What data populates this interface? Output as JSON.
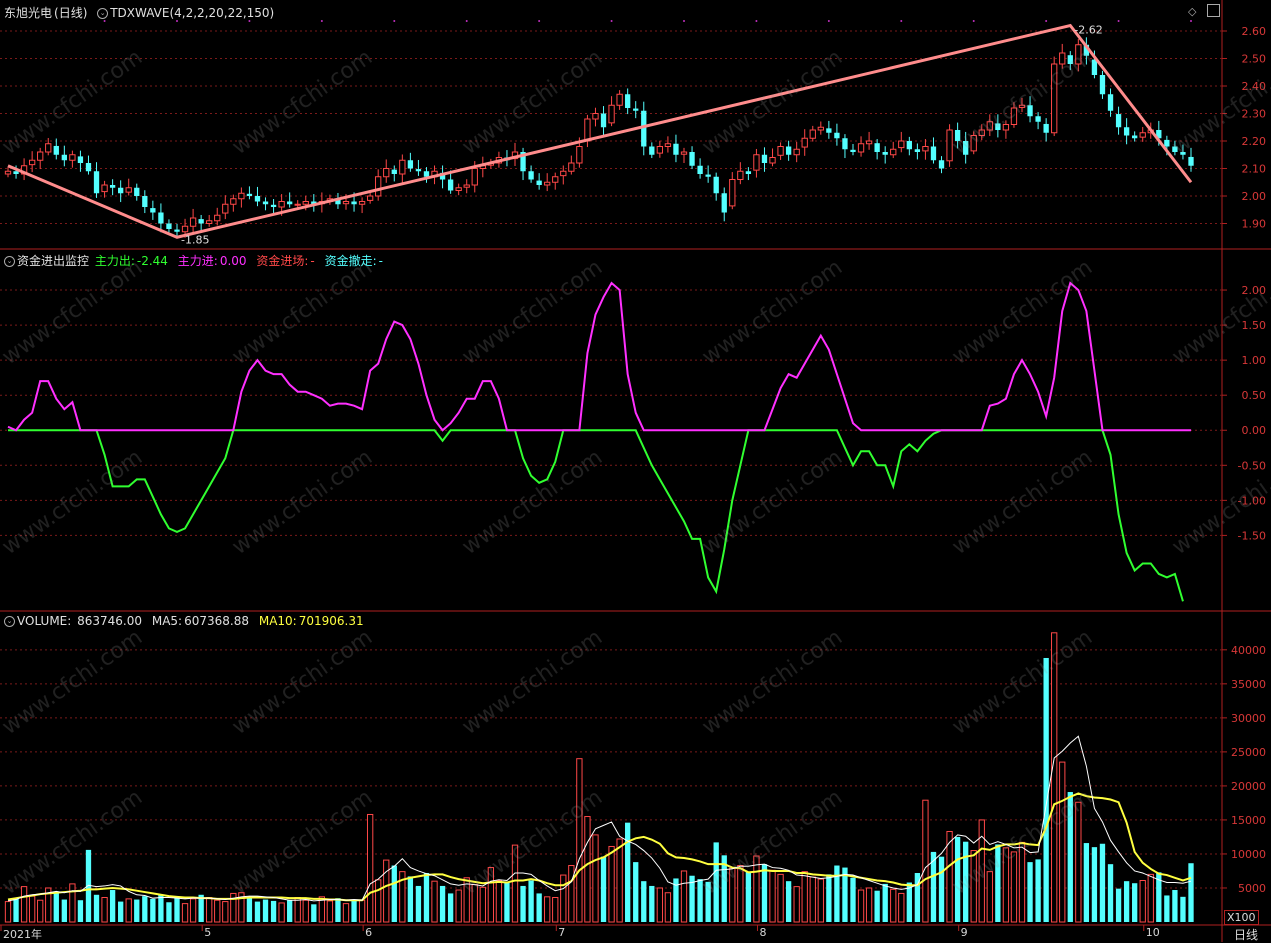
{
  "header": {
    "stock_name": "东旭光电",
    "period_paren": "(日线)",
    "indicator": "TDXWAVE(4,2,2,20,22,150)"
  },
  "panel2": {
    "title": "资金进出监控",
    "main_out_label": "主力出:",
    "main_out_value": "-2.44",
    "main_in_label": "主力进:",
    "main_in_value": "0.00",
    "enter_label": "资金进场:",
    "enter_value": "-",
    "exit_label": "资金撤走:",
    "exit_value": "-"
  },
  "panel3": {
    "title": "VOLUME:",
    "volume_value": "863746.00",
    "ma5_label": "MA5:",
    "ma5_value": "607368.88",
    "ma10_label": "MA10:",
    "ma10_value": "701906.31"
  },
  "watermark": "www.cfchi.com",
  "footer": {
    "multiplier": "X100",
    "period": "日线"
  },
  "colors": {
    "up": "#ff4848",
    "down": "#54ffff",
    "wave": "#ff8c8c",
    "magenta": "#ff30ff",
    "green": "#30ff30",
    "ma5": "#ffffff",
    "ma10": "#ffff40",
    "axis": "#b02020"
  },
  "chart_data": [
    {
      "type": "candlestick",
      "x_tick_labels": [
        "2021年",
        "5",
        "6",
        "7",
        "8",
        "9",
        "10"
      ],
      "x_tick_index": [
        0,
        25,
        45,
        69,
        94,
        119,
        142
      ],
      "ylim": [
        1.84,
        2.64
      ],
      "y_ticks": [
        1.9,
        2.0,
        2.1,
        2.2,
        2.3,
        2.4,
        2.5,
        2.6
      ],
      "wave_points": [
        {
          "i": 0,
          "v": 2.11
        },
        {
          "i": 21,
          "v": 1.85,
          "label": "1.85"
        },
        {
          "i": 132,
          "v": 2.62,
          "label": "2.62"
        },
        {
          "i": 147,
          "v": 2.05
        }
      ],
      "closes": [
        2.09,
        2.08,
        2.11,
        2.13,
        2.16,
        2.19,
        2.15,
        2.13,
        2.15,
        2.12,
        2.09,
        2.01,
        2.04,
        2.03,
        2.01,
        2.03,
        2.0,
        1.96,
        1.94,
        1.9,
        1.88,
        1.87,
        1.89,
        1.92,
        1.9,
        1.91,
        1.93,
        1.97,
        1.99,
        2.01,
        2.0,
        1.98,
        1.97,
        1.96,
        1.98,
        1.97,
        1.97,
        1.98,
        1.97,
        1.98,
        1.99,
        1.97,
        1.98,
        1.97,
        1.98,
        2.0,
        2.07,
        2.1,
        2.08,
        2.13,
        2.1,
        2.09,
        2.07,
        2.09,
        2.06,
        2.02,
        2.03,
        2.04,
        2.1,
        2.11,
        2.12,
        2.14,
        2.13,
        2.16,
        2.09,
        2.06,
        2.04,
        2.05,
        2.07,
        2.09,
        2.12,
        2.18,
        2.28,
        2.3,
        2.25,
        2.33,
        2.37,
        2.32,
        2.31,
        2.18,
        2.15,
        2.18,
        2.19,
        2.15,
        2.16,
        2.11,
        2.08,
        2.07,
        2.01,
        1.94,
        2.06,
        2.09,
        2.08,
        2.15,
        2.12,
        2.14,
        2.18,
        2.15,
        2.17,
        2.21,
        2.24,
        2.25,
        2.23,
        2.21,
        2.17,
        2.16,
        2.19,
        2.2,
        2.16,
        2.15,
        2.17,
        2.2,
        2.17,
        2.16,
        2.18,
        2.13,
        2.1,
        2.24,
        2.2,
        2.15,
        2.22,
        2.24,
        2.27,
        2.24,
        2.26,
        2.32,
        2.33,
        2.29,
        2.27,
        2.23,
        2.48,
        2.52,
        2.48,
        2.55,
        2.51,
        2.44,
        2.37,
        2.31,
        2.25,
        2.22,
        2.21,
        2.23,
        2.24,
        2.21,
        2.18,
        2.16,
        2.15,
        2.11
      ]
    },
    {
      "type": "line",
      "ylim": [
        -2.45,
        2.4
      ],
      "y_ticks": [
        -1.5,
        -1.0,
        -0.5,
        0.0,
        0.5,
        1.0,
        1.5,
        2.0
      ],
      "series": [
        {
          "name": "主力进",
          "values": [
            0.05,
            0.0,
            0.15,
            0.25,
            0.7,
            0.7,
            0.45,
            0.3,
            0.4,
            0,
            0,
            0,
            0,
            0,
            0,
            0,
            0,
            0,
            0,
            0,
            0,
            0,
            0,
            0,
            0,
            0,
            0,
            0,
            0,
            0.55,
            0.85,
            1.0,
            0.85,
            0.8,
            0.8,
            0.65,
            0.55,
            0.55,
            0.5,
            0.45,
            0.35,
            0.38,
            0.38,
            0.35,
            0.3,
            0.85,
            0.95,
            1.3,
            1.55,
            1.5,
            1.3,
            0.95,
            0.5,
            0.15,
            0,
            0.1,
            0.25,
            0.45,
            0.45,
            0.7,
            0.7,
            0.45,
            0,
            0,
            0,
            0,
            0,
            0,
            0,
            0,
            0,
            0,
            1.1,
            1.65,
            1.9,
            2.1,
            2.0,
            0.8,
            0.25,
            0,
            0,
            0,
            0,
            0,
            0,
            0,
            0,
            0,
            0,
            0,
            0,
            0,
            0,
            0,
            0,
            0.3,
            0.6,
            0.8,
            0.75,
            0.95,
            1.15,
            1.35,
            1.15,
            0.8,
            0.45,
            0.1,
            0,
            0,
            0,
            0,
            0,
            0,
            0,
            0,
            0,
            0,
            0,
            0,
            0,
            0,
            0,
            0,
            0.35,
            0.38,
            0.45,
            0.8,
            1.0,
            0.8,
            0.55,
            0.2,
            0.75,
            1.7,
            2.1,
            2.0,
            1.7,
            0.85,
            0,
            0,
            0,
            0,
            0,
            0,
            0,
            0,
            0,
            0,
            0,
            0
          ]
        },
        {
          "name": "主力出",
          "values": [
            0,
            0,
            0,
            0,
            0,
            0,
            0,
            0,
            0,
            0,
            0,
            0,
            -0.35,
            -0.8,
            -0.8,
            -0.8,
            -0.7,
            -0.7,
            -0.95,
            -1.2,
            -1.4,
            -1.45,
            -1.4,
            -1.2,
            -1.0,
            -0.8,
            -0.6,
            -0.4,
            0,
            0,
            0,
            0,
            0,
            0,
            0,
            0,
            0,
            0,
            0,
            0,
            0,
            0,
            0,
            0,
            0,
            0,
            0,
            0,
            0,
            0,
            0,
            0,
            0,
            0,
            -0.15,
            0,
            0,
            0,
            0,
            0,
            0,
            0,
            0,
            0,
            -0.4,
            -0.65,
            -0.75,
            -0.7,
            -0.45,
            0,
            0,
            0,
            0,
            0,
            0,
            0,
            0,
            0,
            0,
            -0.25,
            -0.5,
            -0.7,
            -0.9,
            -1.1,
            -1.3,
            -1.55,
            -1.55,
            -2.1,
            -2.3,
            -1.7,
            -1.0,
            -0.5,
            0,
            0,
            0,
            0,
            0,
            0,
            0,
            0,
            0,
            0,
            0,
            0,
            -0.25,
            -0.5,
            -0.3,
            -0.3,
            -0.5,
            -0.5,
            -0.8,
            -0.3,
            -0.2,
            -0.3,
            -0.15,
            -0.05,
            0,
            0,
            0,
            0,
            0,
            0,
            0,
            0,
            0,
            0,
            0,
            0,
            0,
            0,
            0,
            0,
            0,
            0,
            0,
            0,
            0,
            -0.35,
            -1.2,
            -1.75,
            -2.0,
            -1.9,
            -1.9,
            -2.05,
            -2.1,
            -2.05,
            -2.44
          ]
        }
      ]
    },
    {
      "type": "bar",
      "ylim": [
        0,
        43500
      ],
      "y_ticks": [
        5000,
        10000,
        15000,
        20000,
        25000,
        30000,
        35000,
        40000
      ],
      "unit_multiplier": "X100",
      "values": [
        3000,
        3500,
        5200,
        3800,
        3200,
        5000,
        4200,
        3300,
        5600,
        3200,
        10600,
        4000,
        3600,
        4700,
        3000,
        3400,
        3300,
        3800,
        3400,
        4000,
        2900,
        3700,
        2700,
        3400,
        4000,
        3600,
        3200,
        3000,
        4200,
        4300,
        3600,
        3000,
        3300,
        3100,
        2800,
        3200,
        3600,
        3200,
        2600,
        3700,
        3100,
        3500,
        2700,
        3300,
        3200,
        15800,
        6200,
        9100,
        8300,
        7400,
        6700,
        5300,
        7200,
        6000,
        5300,
        4200,
        4700,
        6500,
        5500,
        5100,
        8000,
        6100,
        5800,
        11300,
        5300,
        6100,
        4200,
        3700,
        3600,
        6900,
        8300,
        24000,
        15500,
        12800,
        9600,
        11100,
        12200,
        14600,
        8800,
        6000,
        5300,
        5000,
        4300,
        6400,
        7500,
        6800,
        6300,
        5900,
        11700,
        9800,
        7900,
        8300,
        7400,
        9700,
        8500,
        7600,
        7000,
        6000,
        5200,
        7400,
        6600,
        6300,
        7000,
        8300,
        8000,
        6500,
        4700,
        5000,
        4600,
        5600,
        4800,
        4200,
        5800,
        7200,
        17900,
        10300,
        9600,
        13300,
        12500,
        11800,
        10500,
        15000,
        7400,
        11400,
        10900,
        10300,
        11700,
        8800,
        9200,
        38800,
        42500,
        23500,
        19100,
        17600,
        11600,
        11000,
        11500,
        8500,
        4900,
        6000,
        5700,
        6100,
        7000,
        7300,
        3900,
        4700,
        3700,
        8637
      ],
      "ma5": [
        3100,
        3300,
        3800,
        4000,
        4100,
        4300,
        4500,
        4300,
        4600,
        4500,
        5400,
        5200,
        5300,
        5500,
        5300,
        4500,
        4000,
        3900,
        3500,
        3600,
        3600,
        3500,
        3400,
        3500,
        3500,
        3500,
        3400,
        3300,
        3500,
        3700,
        3800,
        3800,
        3700,
        3600,
        3400,
        3200,
        3200,
        3300,
        3100,
        3200,
        3300,
        3300,
        3200,
        3300,
        3200,
        5600,
        6300,
        7400,
        8200,
        9300,
        8000,
        7500,
        7100,
        6800,
        6200,
        5600,
        5400,
        5600,
        5500,
        5300,
        6000,
        6200,
        6100,
        7200,
        7200,
        7000,
        6100,
        5300,
        4600,
        4900,
        5900,
        9300,
        11700,
        13700,
        14200,
        14700,
        12600,
        11900,
        11400,
        10500,
        9400,
        7900,
        5900,
        5400,
        5700,
        5800,
        6100,
        6300,
        7600,
        7700,
        7800,
        8200,
        8200,
        8400,
        8500,
        8000,
        7900,
        7600,
        6900,
        6800,
        6600,
        6400,
        6500,
        6700,
        7000,
        6900,
        6500,
        6100,
        5700,
        5300,
        5000,
        4800,
        5000,
        5500,
        8000,
        9000,
        10100,
        11700,
        12800,
        12600,
        11600,
        12600,
        11400,
        11800,
        11400,
        10900,
        11000,
        10200,
        10300,
        17200,
        24100,
        25100,
        26300,
        27300,
        22900,
        16700,
        14700,
        12000,
        10300,
        8700,
        7500,
        7200,
        6700,
        6200,
        5800,
        5800,
        5700,
        6000
      ],
      "ma10": [
        3300,
        3500,
        3700,
        3900,
        4100,
        4200,
        4300,
        4400,
        4500,
        4600,
        4800,
        4800,
        4900,
        5000,
        4900,
        4800,
        4600,
        4400,
        4200,
        4000,
        3800,
        3700,
        3600,
        3600,
        3500,
        3500,
        3400,
        3400,
        3400,
        3500,
        3600,
        3600,
        3600,
        3600,
        3600,
        3500,
        3500,
        3500,
        3400,
        3400,
        3300,
        3300,
        3200,
        3200,
        3200,
        4300,
        4700,
        5300,
        5700,
        6200,
        6500,
        6700,
        6900,
        7000,
        7000,
        6600,
        6300,
        6100,
        5900,
        5700,
        5800,
        5900,
        5800,
        6100,
        6100,
        6300,
        6100,
        5700,
        5400,
        5400,
        6000,
        7600,
        8500,
        9100,
        9500,
        10200,
        11000,
        11800,
        12300,
        12500,
        12100,
        11500,
        10100,
        9500,
        9400,
        9200,
        8900,
        8500,
        8500,
        8500,
        8000,
        7900,
        7300,
        7400,
        7600,
        7500,
        7500,
        7500,
        7200,
        7200,
        7000,
        6900,
        6800,
        6800,
        6900,
        6700,
        6500,
        6300,
        6100,
        6000,
        5800,
        5500,
        5400,
        5400,
        6300,
        6800,
        7300,
        8300,
        9200,
        9600,
        9800,
        10800,
        10600,
        11100,
        11400,
        11400,
        11600,
        11400,
        11300,
        13900,
        17300,
        17800,
        18400,
        18900,
        18500,
        18300,
        18200,
        18000,
        17600,
        14600,
        10300,
        8700,
        7800,
        7100,
        6900,
        6500,
        6100,
        6500
      ]
    }
  ]
}
